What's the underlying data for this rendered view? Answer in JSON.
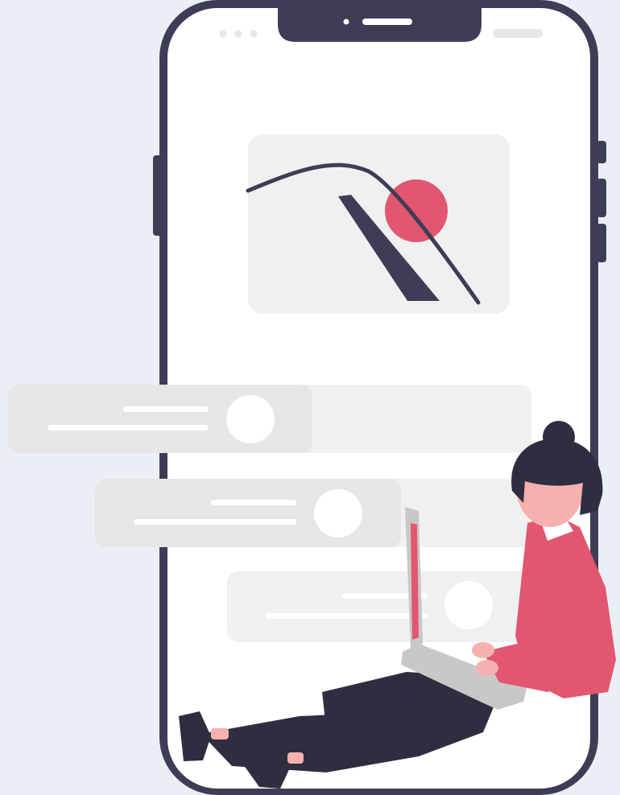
{
  "illustration": {
    "subject": "phone-app-with-woman-using-laptop",
    "colors": {
      "background": "#e9eff5",
      "phone_frame": "#3f3d56",
      "phone_screen": "#ffffff",
      "card": "#f0f0f0",
      "placeholder_bar": "#e6e6e6",
      "placeholder_line": "#ffffff",
      "accent": "#e2566f",
      "skin": "#f6b0ae",
      "hair": "#2f2e41",
      "laptop": "#c8c8c8",
      "pants": "#2f2e41"
    },
    "phone": {
      "status_dots": 3,
      "notch": true
    },
    "cards": [
      {
        "name": "message-card-1",
        "has_avatar": true
      },
      {
        "name": "message-card-2",
        "has_avatar": true
      },
      {
        "name": "message-card-3",
        "has_avatar": true
      }
    ]
  }
}
